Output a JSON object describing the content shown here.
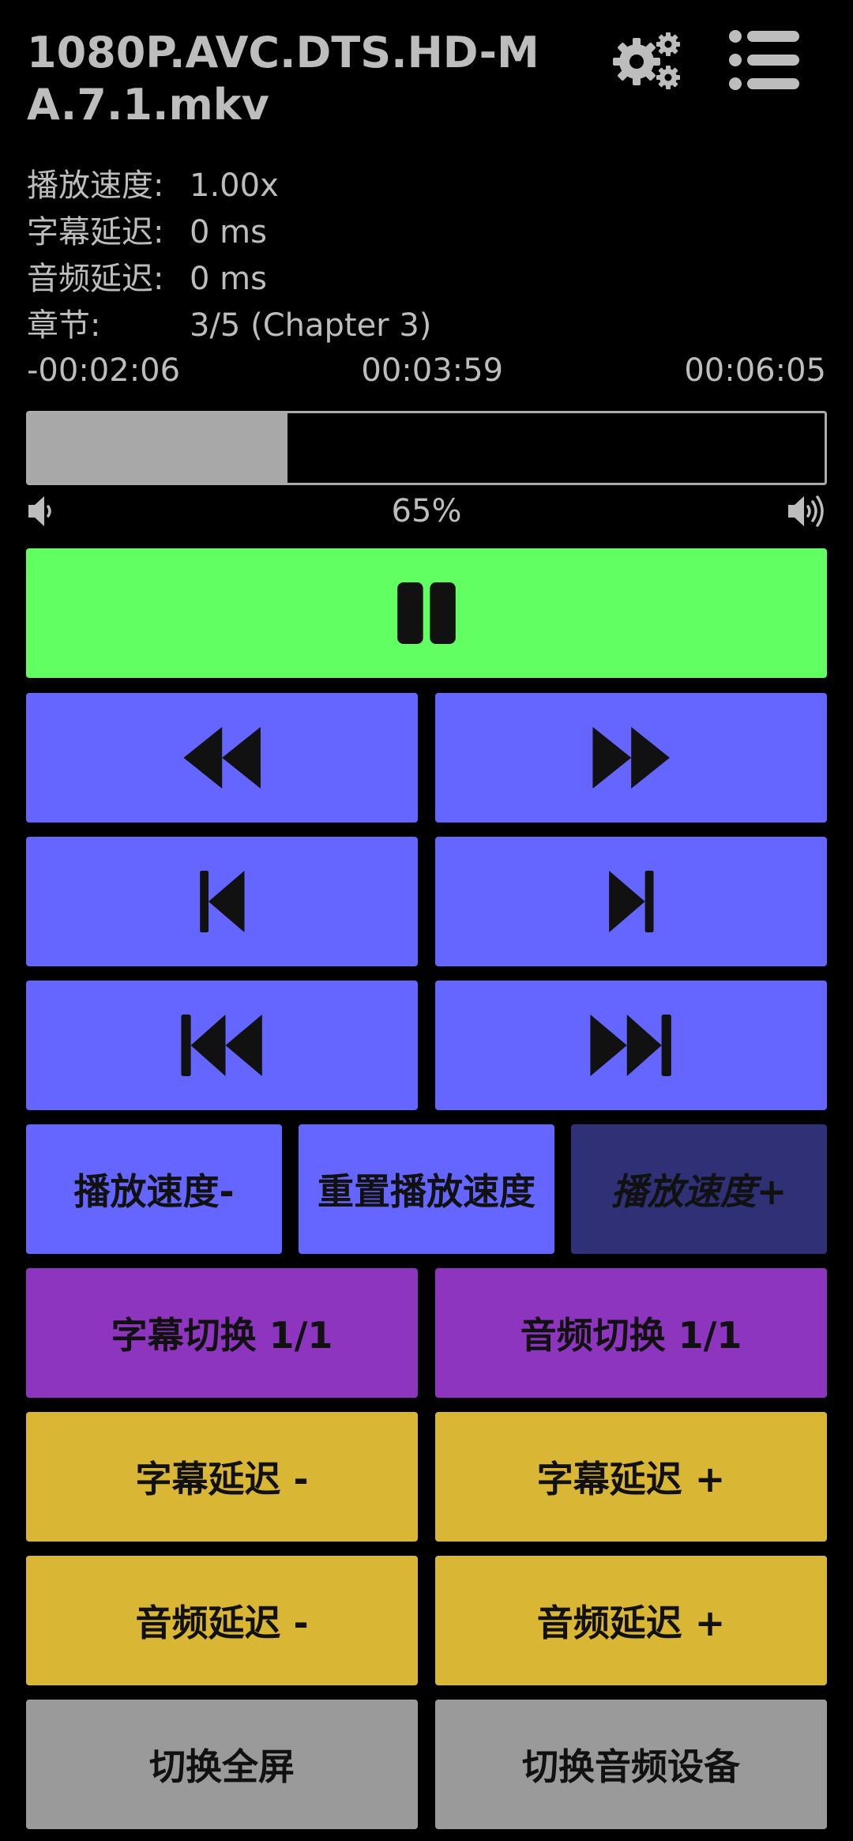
{
  "header": {
    "file_name": "1080P.AVC.DTS.HD-MA.7.1.mkv",
    "settings_icon": "gears-icon",
    "menu_icon": "list-icon"
  },
  "info": [
    {
      "label": "播放速度:",
      "value": "1.00x"
    },
    {
      "label": "字幕延迟:",
      "value": "0 ms"
    },
    {
      "label": "音频延迟:",
      "value": "0 ms"
    },
    {
      "label": "章节:",
      "value": "3/5 (Chapter 3)"
    }
  ],
  "times": {
    "remaining": "-00:02:06",
    "current": "00:03:59",
    "total": "00:06:05"
  },
  "volume": {
    "level_text": "65%",
    "level": 0.325
  },
  "buttons": {
    "speed_down": "播放速度-",
    "speed_reset": "重置播放速度",
    "speed_up": "播放速度+",
    "subtitle_switch": "字幕切换 1/1",
    "audio_switch": "音频切换 1/1",
    "subtitle_delay_minus": "字幕延迟 -",
    "subtitle_delay_plus": "字幕延迟 +",
    "audio_delay_minus": "音频延迟 -",
    "audio_delay_plus": "音频延迟 +",
    "fullscreen": "切换全屏",
    "audio_device": "切换音频设备"
  },
  "colors": {
    "play": "#62ff62",
    "transport": "#6466ff",
    "speed_up_active": "#2f3075",
    "track": "#8d35bf",
    "delay": "#d9b633",
    "misc": "#9a9a9a"
  }
}
